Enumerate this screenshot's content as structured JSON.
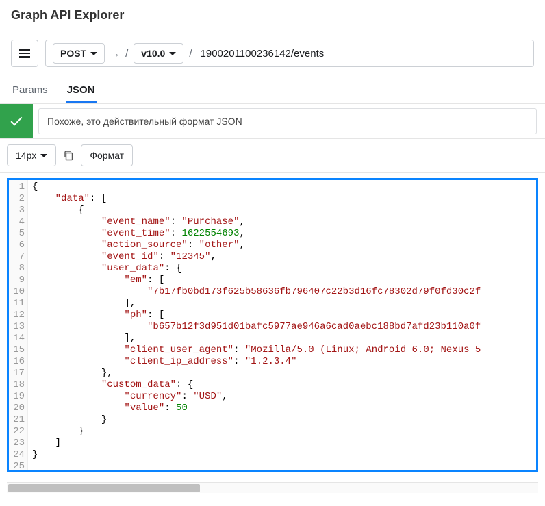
{
  "header": {
    "title": "Graph API Explorer"
  },
  "toolbar": {
    "method": "POST",
    "arrow": "→",
    "slash1": "/",
    "version": "v10.0",
    "slash2": "/",
    "path": "1900201100236142/events"
  },
  "tabs": {
    "params": "Params",
    "json": "JSON"
  },
  "status": {
    "message": "Похоже, это действительный формат JSON"
  },
  "editorToolbar": {
    "fontSize": "14px",
    "format": "Формат"
  },
  "code": {
    "lineCount": 25,
    "tokens": [
      [
        {
          "t": "p",
          "v": "{"
        }
      ],
      [
        {
          "t": "p",
          "v": "    "
        },
        {
          "t": "k",
          "v": "\"data\""
        },
        {
          "t": "p",
          "v": ": ["
        }
      ],
      [
        {
          "t": "p",
          "v": "        {"
        }
      ],
      [
        {
          "t": "p",
          "v": "            "
        },
        {
          "t": "k",
          "v": "\"event_name\""
        },
        {
          "t": "p",
          "v": ": "
        },
        {
          "t": "s",
          "v": "\"Purchase\""
        },
        {
          "t": "p",
          "v": ","
        }
      ],
      [
        {
          "t": "p",
          "v": "            "
        },
        {
          "t": "k",
          "v": "\"event_time\""
        },
        {
          "t": "p",
          "v": ": "
        },
        {
          "t": "n",
          "v": "1622554693"
        },
        {
          "t": "p",
          "v": ","
        }
      ],
      [
        {
          "t": "p",
          "v": "            "
        },
        {
          "t": "k",
          "v": "\"action_source\""
        },
        {
          "t": "p",
          "v": ": "
        },
        {
          "t": "s",
          "v": "\"other\""
        },
        {
          "t": "p",
          "v": ","
        }
      ],
      [
        {
          "t": "p",
          "v": "            "
        },
        {
          "t": "k",
          "v": "\"event_id\""
        },
        {
          "t": "p",
          "v": ": "
        },
        {
          "t": "s",
          "v": "\"12345\""
        },
        {
          "t": "p",
          "v": ","
        }
      ],
      [
        {
          "t": "p",
          "v": "            "
        },
        {
          "t": "k",
          "v": "\"user_data\""
        },
        {
          "t": "p",
          "v": ": {"
        }
      ],
      [
        {
          "t": "p",
          "v": "                "
        },
        {
          "t": "k",
          "v": "\"em\""
        },
        {
          "t": "p",
          "v": ": ["
        }
      ],
      [
        {
          "t": "p",
          "v": "                    "
        },
        {
          "t": "s",
          "v": "\"7b17fb0bd173f625b58636fb796407c22b3d16fc78302d79f0fd30c2f"
        }
      ],
      [
        {
          "t": "p",
          "v": "                ],"
        }
      ],
      [
        {
          "t": "p",
          "v": "                "
        },
        {
          "t": "k",
          "v": "\"ph\""
        },
        {
          "t": "p",
          "v": ": ["
        }
      ],
      [
        {
          "t": "p",
          "v": "                    "
        },
        {
          "t": "s",
          "v": "\"b657b12f3d951d01bafc5977ae946a6cad0aebc188bd7afd23b110a0f"
        }
      ],
      [
        {
          "t": "p",
          "v": "                ],"
        }
      ],
      [
        {
          "t": "p",
          "v": "                "
        },
        {
          "t": "k",
          "v": "\"client_user_agent\""
        },
        {
          "t": "p",
          "v": ": "
        },
        {
          "t": "s",
          "v": "\"Mozilla/5.0 (Linux; Android 6.0; Nexus 5"
        }
      ],
      [
        {
          "t": "p",
          "v": "                "
        },
        {
          "t": "k",
          "v": "\"client_ip_address\""
        },
        {
          "t": "p",
          "v": ": "
        },
        {
          "t": "s",
          "v": "\"1.2.3.4\""
        }
      ],
      [
        {
          "t": "p",
          "v": "            },"
        }
      ],
      [
        {
          "t": "p",
          "v": "            "
        },
        {
          "t": "k",
          "v": "\"custom_data\""
        },
        {
          "t": "p",
          "v": ": {"
        }
      ],
      [
        {
          "t": "p",
          "v": "                "
        },
        {
          "t": "k",
          "v": "\"currency\""
        },
        {
          "t": "p",
          "v": ": "
        },
        {
          "t": "s",
          "v": "\"USD\""
        },
        {
          "t": "p",
          "v": ","
        }
      ],
      [
        {
          "t": "p",
          "v": "                "
        },
        {
          "t": "k",
          "v": "\"value\""
        },
        {
          "t": "p",
          "v": ": "
        },
        {
          "t": "n",
          "v": "50"
        }
      ],
      [
        {
          "t": "p",
          "v": "            }"
        }
      ],
      [
        {
          "t": "p",
          "v": "        }"
        }
      ],
      [
        {
          "t": "p",
          "v": "    ]"
        }
      ],
      [
        {
          "t": "p",
          "v": "}"
        }
      ],
      []
    ]
  }
}
